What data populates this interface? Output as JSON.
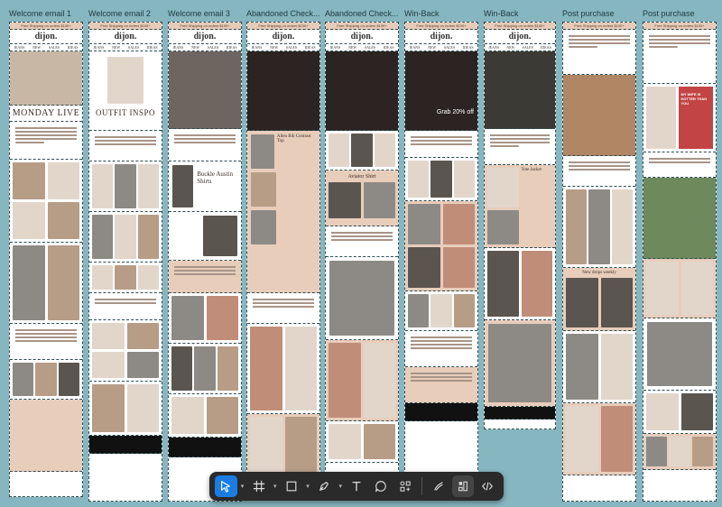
{
  "frames": [
    {
      "label": "Welcome email 1",
      "title": "MONDAY LIVE"
    },
    {
      "label": "Welcome email 2",
      "title": "OUTFIT INSPO"
    },
    {
      "label": "Welcome email 3",
      "title": "Buckle Austin Shirts"
    },
    {
      "label": "Abandoned Check...",
      "title": "Allen Rib Contrast Top"
    },
    {
      "label": "Abandoned Check...",
      "title": "Aviator Shirt"
    },
    {
      "label": "Win-Back",
      "title": "Grab 20% off"
    },
    {
      "label": "Win-Back",
      "title": "Tote Jacket"
    },
    {
      "label": "Post purchase",
      "title": "New drops weekly"
    },
    {
      "label": "Post purchase",
      "title": "MY WIFE IS HOTTER THAN YOU"
    }
  ],
  "email": {
    "logo": "dijon.",
    "nav": [
      "JEANS",
      "NEW",
      "SALES",
      "IDEAS"
    ],
    "promo": "Free Shipping on orders $100+",
    "cta": "SHOP NOW"
  },
  "toolbar": {
    "tools": [
      "move-tool",
      "frame-tool",
      "shape-tool",
      "pen-tool",
      "text-tool",
      "comment-tool",
      "actions-tool",
      "dev-mode-tool",
      "code-tool"
    ],
    "active": "move-tool",
    "accent": "#1b7de3"
  }
}
